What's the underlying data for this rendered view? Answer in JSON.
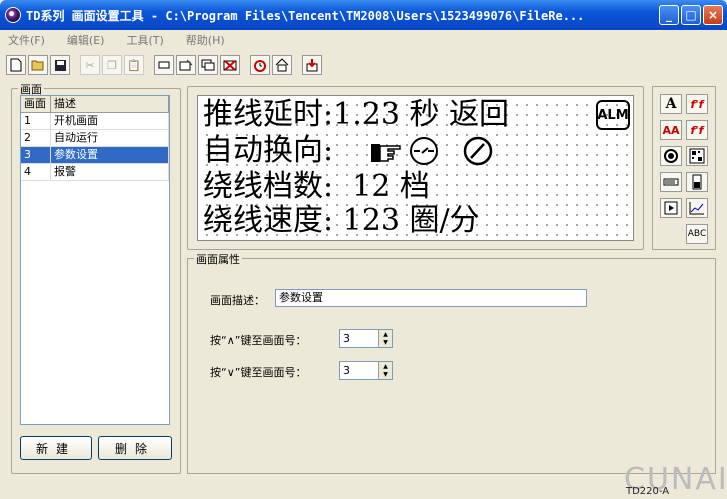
{
  "window": {
    "title": "TD系列 画面设置工具 - C:\\Program Files\\Tencent\\TM2008\\Users\\1523499076\\FileRe...",
    "minimize": "_",
    "maximize": "□",
    "close": "×"
  },
  "menu": [
    "文件(F)",
    "编辑(E)",
    "工具(T)",
    "帮助(H)"
  ],
  "toolbar": {
    "icons": [
      "new-file-icon",
      "open-folder-icon",
      "save-icon",
      "cut-icon",
      "copy-icon",
      "paste-icon",
      "rect-icon",
      "edit-screen-icon",
      "copy-screen-icon",
      "delete-screen-icon",
      "alarm-clock-icon",
      "home-icon",
      "download-icon"
    ]
  },
  "screens": {
    "title": "画面",
    "columns": [
      "画面",
      "描述"
    ],
    "rows": [
      {
        "num": "1",
        "desc": "开机画面"
      },
      {
        "num": "2",
        "desc": "自动运行"
      },
      {
        "num": "3",
        "desc": "参数设置"
      },
      {
        "num": "4",
        "desc": "报警"
      }
    ],
    "new_label": "新建",
    "delete_label": "删除"
  },
  "lcd": {
    "line1": "推线延时:1.23 秒 返回",
    "line2": "自动换向:",
    "line3": "绕线档数:  12 档",
    "line4": "绕线速度: 123 圈/分",
    "alm_label": "ALM"
  },
  "palette": {
    "text_a": "A",
    "text_ff": "f'f",
    "text_aa": "AA",
    "text_ff2": "f'f",
    "abc": "ABC"
  },
  "properties": {
    "title": "画面属性",
    "desc_label": "画面描述：",
    "desc_value": "参数设置",
    "up_label": "按“∧”键至画面号：",
    "up_value": "3",
    "down_label": "按“∨”键至画面号：",
    "down_value": "3"
  },
  "status": {
    "model": "TD220-A"
  },
  "watermark": "CUNAI"
}
